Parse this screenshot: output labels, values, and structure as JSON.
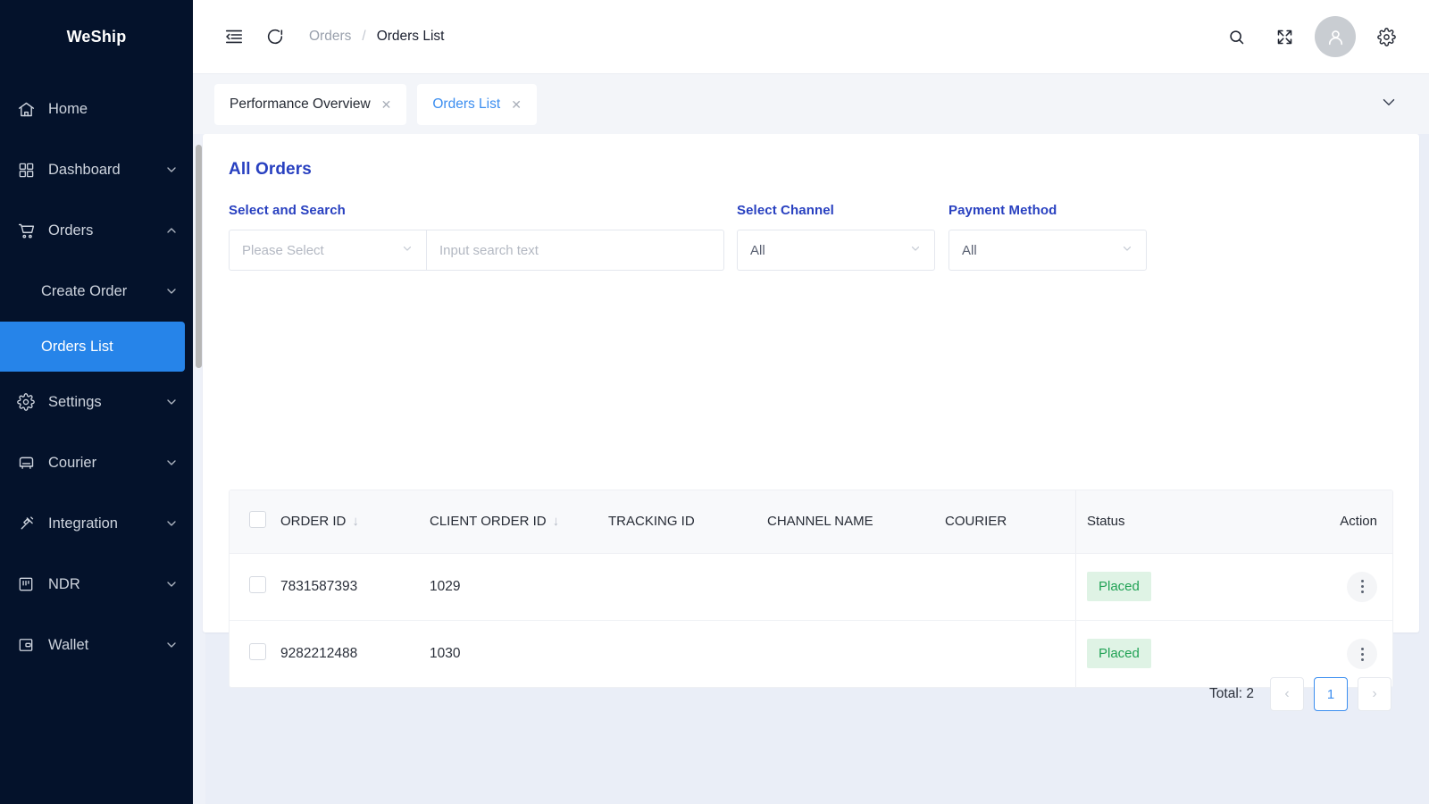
{
  "sidebar": {
    "brand": "WeShip",
    "items": [
      {
        "label": "Home",
        "icon": "home-icon",
        "caret": false,
        "active": false,
        "sub": false
      },
      {
        "label": "Dashboard",
        "icon": "grid-icon",
        "caret": true,
        "active": false,
        "sub": false,
        "caret_dir": "down"
      },
      {
        "label": "Orders",
        "icon": "cart-icon",
        "caret": true,
        "active": false,
        "sub": false,
        "caret_dir": "up"
      },
      {
        "label": "Create Order",
        "icon": "none",
        "caret": true,
        "active": false,
        "sub": true,
        "caret_dir": "down"
      },
      {
        "label": "Orders List",
        "icon": "none",
        "caret": false,
        "active": true,
        "sub": true
      },
      {
        "label": "Settings",
        "icon": "gear-icon",
        "caret": true,
        "active": false,
        "sub": false,
        "caret_dir": "down"
      },
      {
        "label": "Courier",
        "icon": "truck-icon",
        "caret": true,
        "active": false,
        "sub": false,
        "caret_dir": "down"
      },
      {
        "label": "Integration",
        "icon": "plug-icon",
        "caret": true,
        "active": false,
        "sub": false,
        "caret_dir": "down"
      },
      {
        "label": "NDR",
        "icon": "ndr-icon",
        "caret": true,
        "active": false,
        "sub": false,
        "caret_dir": "down"
      },
      {
        "label": "Wallet",
        "icon": "wallet-icon",
        "caret": true,
        "active": false,
        "sub": false,
        "caret_dir": "down"
      }
    ]
  },
  "topbar": {
    "collapse_icon": "menu-collapse-icon",
    "refresh_icon": "refresh-icon",
    "breadcrumb": {
      "parent": "Orders",
      "separator": "/",
      "current": "Orders List"
    },
    "search_icon": "search-icon",
    "fullscreen_icon": "fullscreen-icon",
    "avatar_icon": "user-avatar-icon",
    "settings_icon": "gear-icon"
  },
  "tabs": {
    "items": [
      {
        "label": "Performance Overview",
        "close": "✕",
        "active": false
      },
      {
        "label": "Orders List",
        "close": "✕",
        "active": true
      }
    ],
    "expand_icon": "chevron-down-icon"
  },
  "page": {
    "title": "All Orders",
    "filters": [
      {
        "label": "Select and Search",
        "type": "select-plus-input",
        "select_placeholder": "Please Select",
        "input_placeholder": "Input search text"
      },
      {
        "label": "Select Channel",
        "type": "select",
        "value": "All"
      },
      {
        "label": "Payment Method",
        "type": "select",
        "value": "All"
      }
    ],
    "table": {
      "columns": [
        {
          "key": "checkbox",
          "label": "",
          "sortable": false
        },
        {
          "key": "order_id",
          "label": "ORDER ID",
          "sortable": true
        },
        {
          "key": "client_id",
          "label": "CLIENT ORDER ID",
          "sortable": true
        },
        {
          "key": "tracking",
          "label": "TRACKING ID",
          "sortable": false
        },
        {
          "key": "channel",
          "label": "CHANNEL NAME",
          "sortable": false
        },
        {
          "key": "courier",
          "label": "COURIER",
          "sortable": false
        },
        {
          "key": "status",
          "label": "Status",
          "sortable": false
        },
        {
          "key": "action",
          "label": "Action",
          "sortable": false
        }
      ],
      "sort_glyph": "↓",
      "rows": [
        {
          "order_id": "7831587393",
          "client_id": "1029",
          "tracking": "",
          "channel": "",
          "courier": "",
          "status": "Placed"
        },
        {
          "order_id": "9282212488",
          "client_id": "1030",
          "tracking": "",
          "channel": "",
          "courier": "",
          "status": "Placed"
        }
      ]
    },
    "pagination": {
      "total_text": "Total: 2",
      "prev": "‹",
      "current_page": "1",
      "next": "›"
    }
  },
  "colors": {
    "sidebar_bg": "#04122b",
    "accent_blue": "#2684e9",
    "title_blue": "#2840c0",
    "tab_active": "#3c8ef0",
    "status_green_text": "#21a255",
    "status_green_bg": "#dff3e5",
    "page_bg": "#eaeef7"
  }
}
